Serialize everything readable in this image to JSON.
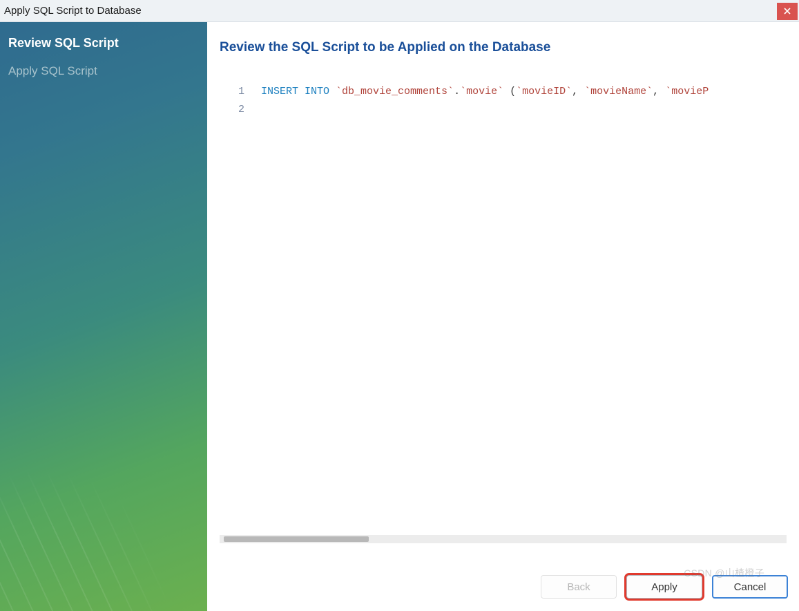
{
  "window": {
    "title": "Apply SQL Script to Database"
  },
  "sidebar": {
    "steps": [
      {
        "label": "Review SQL Script",
        "active": true
      },
      {
        "label": "Apply SQL Script",
        "active": false
      }
    ]
  },
  "content": {
    "heading": "Review the SQL Script to be Applied on the Database",
    "code": {
      "lines": [
        {
          "num": "1",
          "tokens": [
            {
              "t": "INSERT INTO ",
              "cls": "kw"
            },
            {
              "t": "`db_movie_comments`",
              "cls": "ident"
            },
            {
              "t": ".",
              "cls": "punct"
            },
            {
              "t": "`movie`",
              "cls": "ident"
            },
            {
              "t": " (",
              "cls": "punct"
            },
            {
              "t": "`movieID`",
              "cls": "ident"
            },
            {
              "t": ", ",
              "cls": "punct"
            },
            {
              "t": "`movieName`",
              "cls": "ident"
            },
            {
              "t": ", ",
              "cls": "punct"
            },
            {
              "t": "`movieP",
              "cls": "ident"
            }
          ]
        },
        {
          "num": "2",
          "tokens": []
        }
      ]
    }
  },
  "buttons": {
    "back": "Back",
    "apply": "Apply",
    "cancel": "Cancel"
  },
  "watermark": "CSDN @山楂橙子"
}
